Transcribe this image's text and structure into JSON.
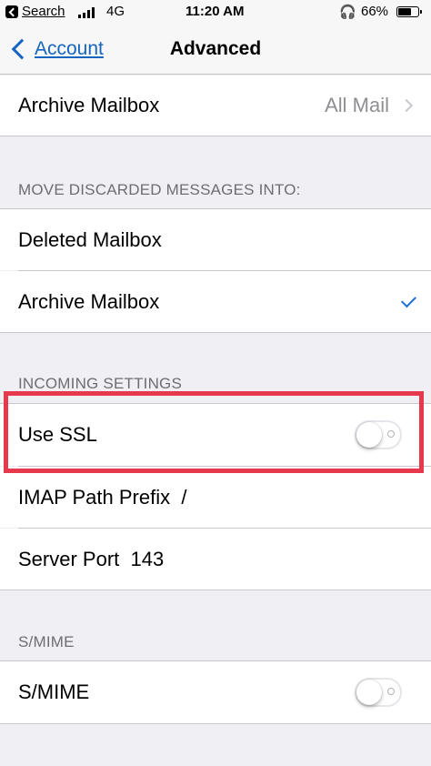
{
  "status_bar": {
    "back_app": "Search",
    "carrier": "4G",
    "time": "11:20 AM",
    "battery_percent": "66%",
    "battery_level": 0.66,
    "signal_bars": 4
  },
  "nav": {
    "back_label": "Account",
    "title": "Advanced"
  },
  "archive_row": {
    "label": "Archive Mailbox",
    "value": "All Mail"
  },
  "discarded_section": {
    "header": "MOVE DISCARDED MESSAGES INTO:",
    "options": [
      {
        "label": "Deleted Mailbox",
        "selected": false
      },
      {
        "label": "Archive Mailbox",
        "selected": true
      }
    ]
  },
  "incoming_section": {
    "header": "INCOMING SETTINGS",
    "use_ssl": {
      "label": "Use SSL",
      "on": false
    },
    "imap_prefix": {
      "label": "IMAP Path Prefix",
      "value": "/"
    },
    "server_port": {
      "label": "Server Port",
      "value": "143"
    }
  },
  "smime_section": {
    "header": "S/MIME",
    "smime": {
      "label": "S/MIME",
      "on": false
    }
  },
  "colors": {
    "accent": "#1565c0",
    "highlight_border": "#e6394b",
    "background": "#efeff4"
  }
}
